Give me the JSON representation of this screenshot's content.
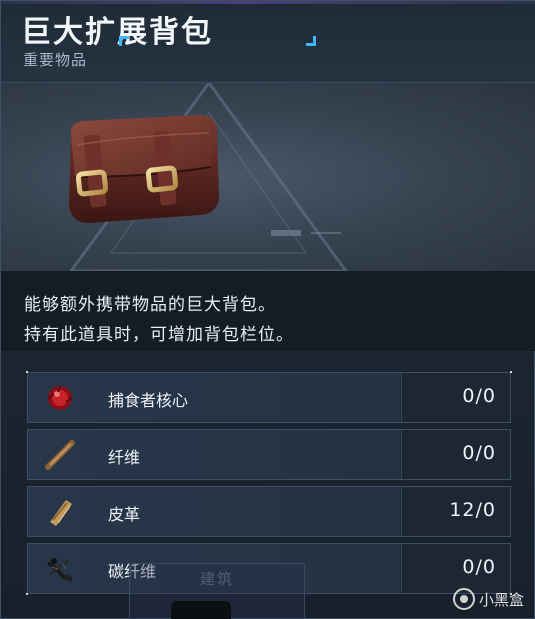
{
  "item": {
    "title": "巨大扩展背包",
    "category": "重要物品",
    "image_icon": "leather-backpack-icon"
  },
  "description": {
    "line1": "能够额外携带物品的巨大背包。",
    "line2": "持有此道具时，可增加背包栏位。"
  },
  "materials": [
    {
      "name": "捕食者核心",
      "count": "0/0",
      "icon": "predator-core-icon"
    },
    {
      "name": "纤维",
      "count": "0/0",
      "icon": "fiber-icon"
    },
    {
      "name": "皮革",
      "count": "12/0",
      "icon": "leather-icon"
    },
    {
      "name": "碳纤维",
      "count": "0/0",
      "icon": "carbon-fiber-icon"
    }
  ],
  "footer": {
    "build_label": "建筑",
    "watermark": "小黑盒"
  },
  "colors": {
    "accent": "#3fb8ff",
    "panel_bg": "#1d2733",
    "text": "#e6ecf2"
  }
}
